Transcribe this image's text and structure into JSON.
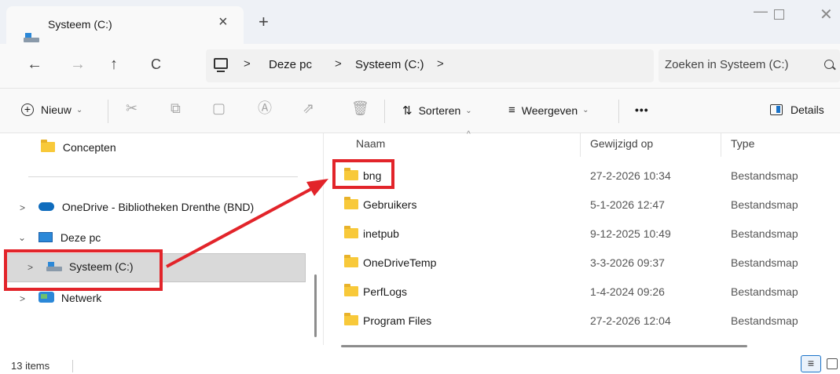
{
  "window": {
    "tab_title": "Systeem (C:)",
    "tab_close": "×",
    "new_tab": "+",
    "minimize": "—",
    "close": "✕"
  },
  "nav_buttons": {
    "back": "←",
    "forward": "→",
    "up": "↑",
    "refresh": "C"
  },
  "breadcrumb": {
    "items": [
      "Deze pc",
      "Systeem (C:)"
    ],
    "separator": ">"
  },
  "search": {
    "placeholder": "Zoeken in Systeem (C:)"
  },
  "toolbar": {
    "new_label": "Nieuw",
    "sort_label": "Sorteren",
    "view_label": "Weergeven",
    "more_label": "•••",
    "details_label": "Details"
  },
  "navpane": {
    "items": [
      {
        "label": "Concepten"
      },
      {
        "label": "OneDrive - Bibliotheken Drenthe (BND)"
      },
      {
        "label": "Deze pc"
      },
      {
        "label": "Systeem (C:)"
      },
      {
        "label": "Netwerk"
      }
    ]
  },
  "columns": {
    "name": "Naam",
    "modified": "Gewijzigd op",
    "type": "Type"
  },
  "files": [
    {
      "name": "bng",
      "modified": "27-2-2026 10:34",
      "type": "Bestandsmap"
    },
    {
      "name": "Gebruikers",
      "modified": "5-1-2026 12:47",
      "type": "Bestandsmap"
    },
    {
      "name": "inetpub",
      "modified": "9-12-2025 10:49",
      "type": "Bestandsmap"
    },
    {
      "name": "OneDriveTemp",
      "modified": "3-3-2026 09:37",
      "type": "Bestandsmap"
    },
    {
      "name": "PerfLogs",
      "modified": "1-4-2024 09:26",
      "type": "Bestandsmap"
    },
    {
      "name": "Program Files",
      "modified": "27-2-2026 12:04",
      "type": "Bestandsmap"
    }
  ],
  "status": {
    "count": "13 items"
  },
  "colors": {
    "annotation": "#e2242a",
    "folder": "#f8c93a",
    "accent": "#1a73c9"
  }
}
